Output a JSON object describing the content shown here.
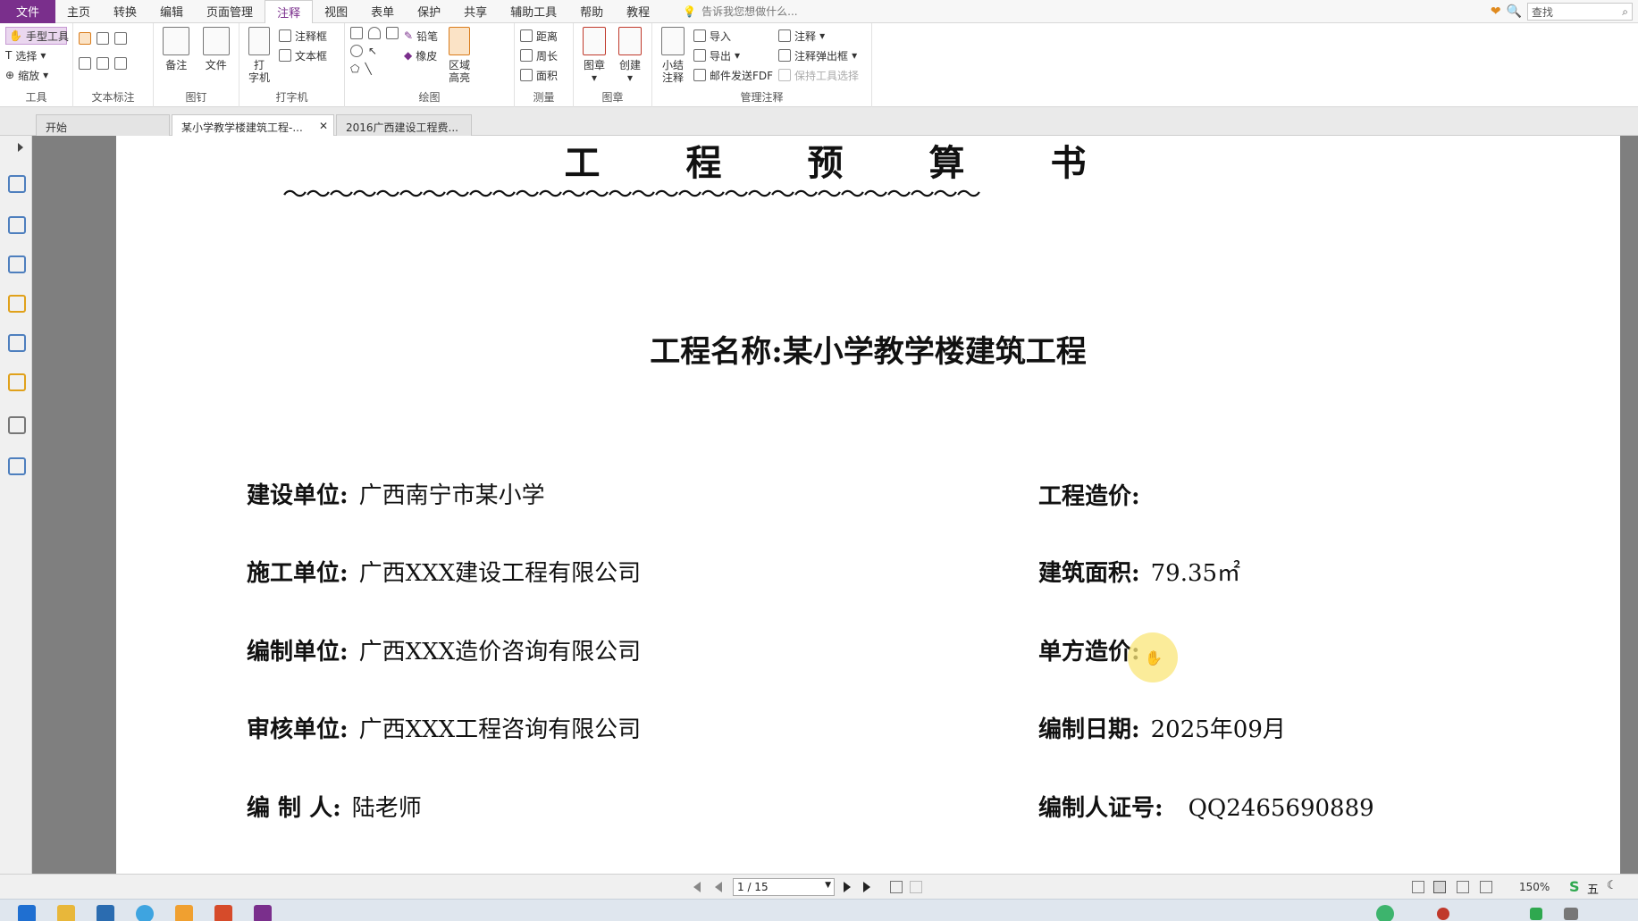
{
  "menubar": {
    "file": "文件",
    "items": [
      "主页",
      "转换",
      "编辑",
      "页面管理",
      "注释",
      "视图",
      "表单",
      "保护",
      "共享",
      "辅助工具",
      "帮助",
      "教程"
    ],
    "active_index": 4,
    "tell_me": "告诉我您想做什么...",
    "search_placeholder": "查找"
  },
  "ribbon": {
    "tools": {
      "hand": "手型工具",
      "select": "选择",
      "zoom": "缩放",
      "label": "工具"
    },
    "text_markup": {
      "label": "文本标注"
    },
    "pin": {
      "note": "备注",
      "file": "文件",
      "label": "图钉"
    },
    "typewriter": {
      "typewriter_top": "打",
      "typewriter_bottom": "字机",
      "callout": "注释框",
      "textbox": "文本框",
      "label": "打字机"
    },
    "drawing": {
      "pencil": "铅笔",
      "eraser": "橡皮",
      "highlight_top": "区域",
      "highlight_bottom": "高亮",
      "label": "绘图"
    },
    "measure": {
      "distance": "距离",
      "perimeter": "周长",
      "area": "面积",
      "label": "测量"
    },
    "stamp": {
      "stamp": "图章",
      "create": "创建",
      "label": "图章"
    },
    "manage": {
      "summary_top": "小结",
      "summary_bottom": "注释",
      "import": "导入",
      "export": "导出",
      "email": "邮件发送FDF",
      "comment": "注释",
      "popup": "注释弹出框",
      "keep": "保持工具选择",
      "label": "管理注释"
    }
  },
  "tabs": [
    {
      "label": "开始"
    },
    {
      "label": "某小学教学楼建筑工程-..."
    },
    {
      "label": "2016广西建设工程费..."
    }
  ],
  "page": {
    "title": "工程预算书",
    "wave": "～～～～～～～～～～～～～～～～～～～～～～～～～～～～～～",
    "project_name": "工程名称:某小学教学楼建筑工程",
    "left_fields": [
      {
        "label": "建设单位:",
        "value": "广西南宁市某小学"
      },
      {
        "label": "施工单位:",
        "value": "广西XXX建设工程有限公司"
      },
      {
        "label": "编制单位:",
        "value": "广西XXX造价咨询有限公司"
      },
      {
        "label": "审核单位:",
        "value": "广西XXX工程咨询有限公司"
      },
      {
        "label": "编 制 人:",
        "value": "陆老师"
      }
    ],
    "right_fields": [
      {
        "label": "工程造价:",
        "value": ""
      },
      {
        "label": "建筑面积:",
        "value": "79.35㎡"
      },
      {
        "label": "单方造价:",
        "value": ""
      },
      {
        "label": "编制日期:",
        "value": "2025年09月"
      },
      {
        "label": "编制人证号:",
        "value": "QQ2465690889"
      }
    ]
  },
  "statusbar": {
    "page_indicator": "1 / 15",
    "zoom": "150%",
    "ime": "五"
  },
  "colors": {
    "accent": "#7a2f8c",
    "page_bg": "#ffffff",
    "workspace": "#7f7f7f"
  }
}
